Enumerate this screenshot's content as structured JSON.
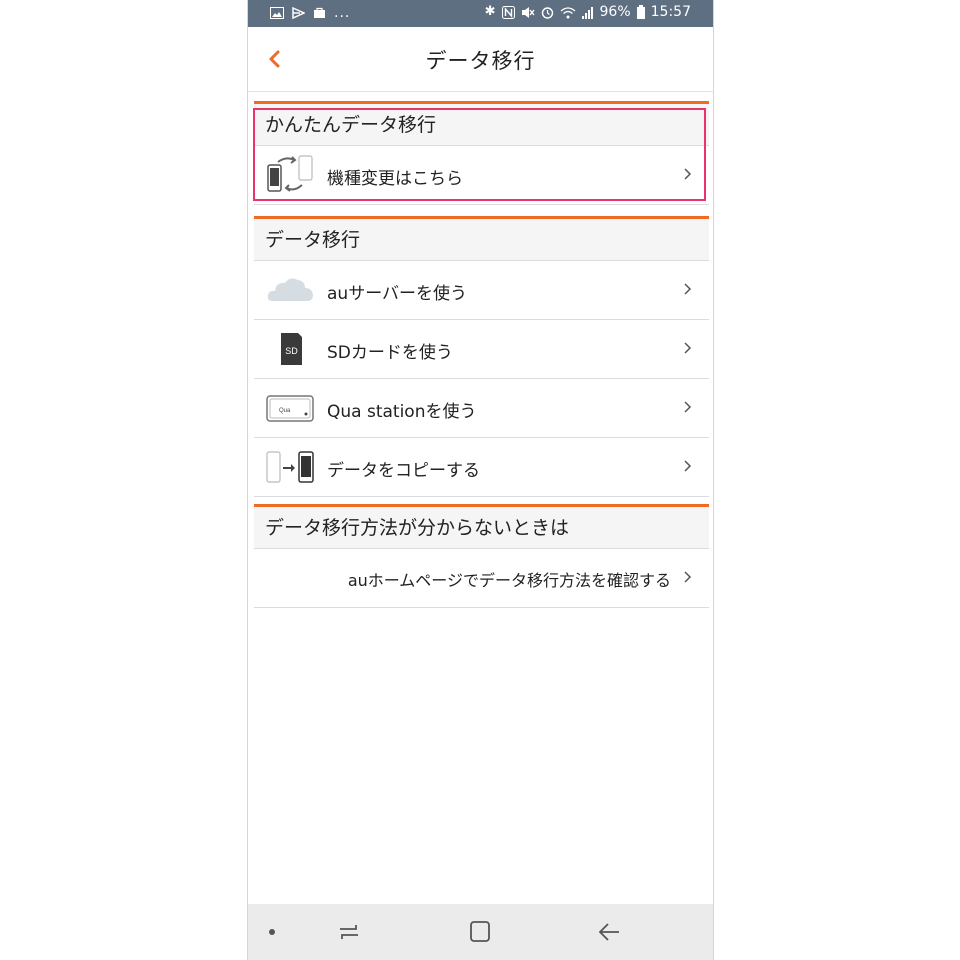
{
  "status_bar": {
    "left_icons": [
      "image-icon",
      "cast-icon",
      "bag-icon"
    ],
    "more": "...",
    "battery": "96%",
    "time": "15:57"
  },
  "header": {
    "title": "データ移行"
  },
  "sections": {
    "easy": {
      "title": "かんたんデータ移行",
      "items": [
        {
          "label": "機種変更はこちら",
          "icon": "phone-swap-icon"
        }
      ]
    },
    "transfer": {
      "title": "データ移行",
      "items": [
        {
          "label": "auサーバーを使う",
          "icon": "cloud-icon"
        },
        {
          "label": "SDカードを使う",
          "icon": "sd-card-icon",
          "icon_text": "SD"
        },
        {
          "label": "Qua stationを使う",
          "icon": "qua-station-icon",
          "icon_text": "Qua"
        },
        {
          "label": "データをコピーする",
          "icon": "phone-copy-icon"
        }
      ]
    },
    "help": {
      "title": "データ移行方法が分からないときは",
      "link_label": "auホームページでデータ移行方法を確認する"
    }
  },
  "colors": {
    "accent": "#f06a25",
    "highlight": "#e8336b",
    "status_bar": "#5f6f82"
  }
}
